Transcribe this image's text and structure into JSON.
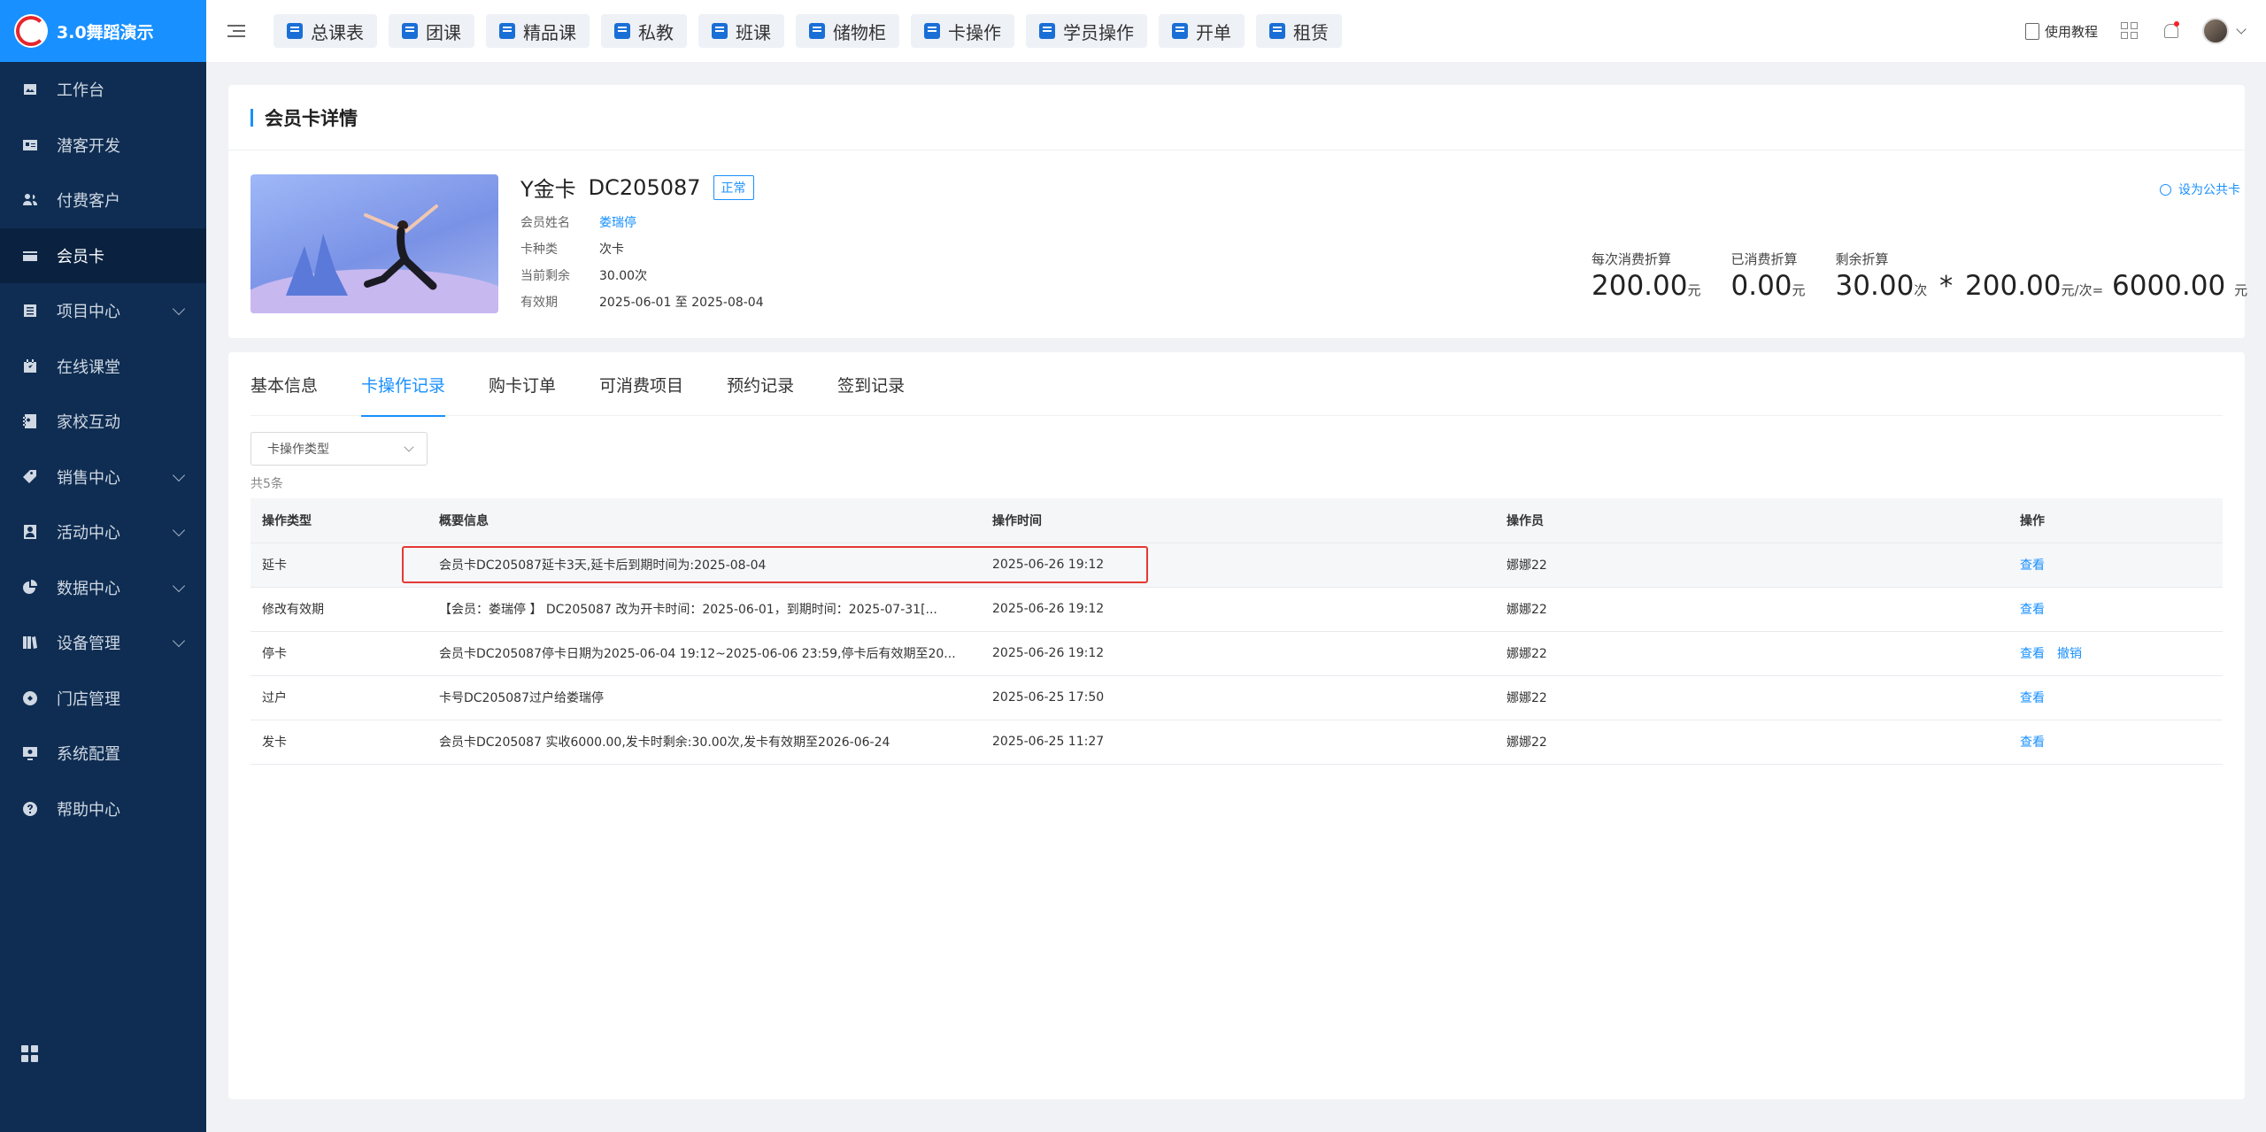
{
  "app": {
    "name": "3.0舞蹈演示"
  },
  "sidebar": {
    "items": [
      {
        "label": "工作台",
        "icon": "image-icon",
        "expandable": false,
        "active": false
      },
      {
        "label": "潜客开发",
        "icon": "id-card-icon",
        "expandable": false,
        "active": false
      },
      {
        "label": "付费客户",
        "icon": "users-icon",
        "expandable": false,
        "active": false
      },
      {
        "label": "会员卡",
        "icon": "card-icon",
        "expandable": false,
        "active": true
      },
      {
        "label": "项目中心",
        "icon": "list-icon",
        "expandable": true,
        "active": false
      },
      {
        "label": "在线课堂",
        "icon": "calendar-icon",
        "expandable": false,
        "active": false
      },
      {
        "label": "家校互动",
        "icon": "contact-book-icon",
        "expandable": false,
        "active": false
      },
      {
        "label": "销售中心",
        "icon": "tag-icon",
        "expandable": true,
        "active": false
      },
      {
        "label": "活动中心",
        "icon": "portrait-icon",
        "expandable": true,
        "active": false
      },
      {
        "label": "数据中心",
        "icon": "pie-chart-icon",
        "expandable": true,
        "active": false
      },
      {
        "label": "设备管理",
        "icon": "books-icon",
        "expandable": true,
        "active": false
      },
      {
        "label": "门店管理",
        "icon": "store-icon",
        "expandable": false,
        "active": false
      },
      {
        "label": "系统配置",
        "icon": "settings-monitor-icon",
        "expandable": false,
        "active": false
      },
      {
        "label": "帮助中心",
        "icon": "help-icon",
        "expandable": false,
        "active": false
      }
    ]
  },
  "topbar": {
    "quick_links": [
      "总课表",
      "团课",
      "精品课",
      "私教",
      "班课",
      "储物柜",
      "卡操作",
      "学员操作",
      "开单",
      "租赁"
    ],
    "help_label": "使用教程"
  },
  "card_detail": {
    "section_title": "会员卡详情",
    "card_name": "Y金卡",
    "card_no": "DC205087",
    "status": "正常",
    "set_public_label": "设为公共卡",
    "info": [
      {
        "key": "会员姓名",
        "value": "娄瑞停",
        "link": true
      },
      {
        "key": "卡种类",
        "value": "次卡",
        "link": false
      },
      {
        "key": "当前剩余",
        "value": "30.00次",
        "link": false
      },
      {
        "key": "有效期",
        "value": "2025-06-01 至 2025-08-04",
        "link": false
      }
    ],
    "stats": {
      "per_use_label": "每次消费折算",
      "per_use_value": "200.00",
      "per_use_unit": "元",
      "used_label": "已消费折算",
      "used_value": "0.00",
      "used_unit": "元",
      "remain_label": "剩余折算",
      "remain_count": "30.00",
      "remain_count_unit": "次",
      "multiply": "*",
      "remain_price": "200.00",
      "remain_price_unit": "元/次=",
      "remain_total": "6000.00",
      "remain_total_unit": "元"
    }
  },
  "records": {
    "tabs": [
      {
        "label": "基本信息",
        "active": false
      },
      {
        "label": "卡操作记录",
        "active": true
      },
      {
        "label": "购卡订单",
        "active": false
      },
      {
        "label": "可消费项目",
        "active": false
      },
      {
        "label": "预约记录",
        "active": false
      },
      {
        "label": "签到记录",
        "active": false
      }
    ],
    "filter_placeholder": "卡操作类型",
    "total_label": "共5条",
    "columns": [
      "操作类型",
      "概要信息",
      "操作时间",
      "操作员",
      "操作"
    ],
    "rows": [
      {
        "type": "延卡",
        "summary": "会员卡DC205087延卡3天,延卡后到期时间为:2025-08-04",
        "time": "2025-06-26 19:12",
        "operator": "娜娜22",
        "actions": [
          "查看"
        ]
      },
      {
        "type": "修改有效期",
        "summary": "【会员：娄瑞停 】 DC205087 改为开卡时间：2025-06-01，到期时间：2025-07-31[...",
        "time": "2025-06-26 19:12",
        "operator": "娜娜22",
        "actions": [
          "查看"
        ]
      },
      {
        "type": "停卡",
        "summary": "会员卡DC205087停卡日期为2025-06-04 19:12~2025-06-06 23:59,停卡后有效期至20...",
        "time": "2025-06-26 19:12",
        "operator": "娜娜22",
        "actions": [
          "查看",
          "撤销"
        ]
      },
      {
        "type": "过户",
        "summary": "卡号DC205087过户给娄瑞停",
        "time": "2025-06-25 17:50",
        "operator": "娜娜22",
        "actions": [
          "查看"
        ]
      },
      {
        "type": "发卡",
        "summary": "会员卡DC205087 实收6000.00,发卡时剩余:30.00次,发卡有效期至2026-06-24",
        "time": "2025-06-25 11:27",
        "operator": "娜娜22",
        "actions": [
          "查看"
        ]
      }
    ]
  },
  "colors": {
    "accent": "#1890ff",
    "sidebar_bg": "#0f2d52",
    "highlight": "#e53935"
  }
}
